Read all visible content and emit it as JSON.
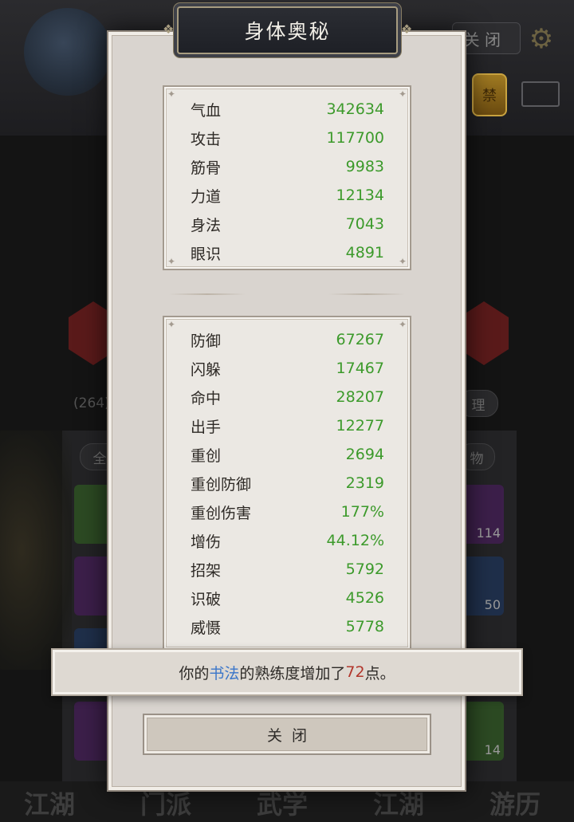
{
  "background": {
    "close_label": "关 闭",
    "badge_char": "禁",
    "count_text": "(264)",
    "manage_label": "理",
    "filter_left_label": "全",
    "filter_right_label": "物",
    "slot_counts": [
      "114",
      "50",
      "14"
    ],
    "nav_labels": [
      "江湖",
      "门派",
      "武学",
      "江湖",
      "游历"
    ]
  },
  "dialog": {
    "title": "身体奥秘",
    "primary_stats": [
      {
        "label": "气血",
        "value": "342634"
      },
      {
        "label": "攻击",
        "value": "117700"
      },
      {
        "label": "筋骨",
        "value": "9983"
      },
      {
        "label": "力道",
        "value": "12134"
      },
      {
        "label": "身法",
        "value": "7043"
      },
      {
        "label": "眼识",
        "value": "4891"
      }
    ],
    "secondary_stats": [
      {
        "label": "防御",
        "value": "67267"
      },
      {
        "label": "闪躲",
        "value": "17467"
      },
      {
        "label": "命中",
        "value": "28207"
      },
      {
        "label": "出手",
        "value": "12277"
      },
      {
        "label": "重创",
        "value": "2694"
      },
      {
        "label": "重创防御",
        "value": "2319"
      },
      {
        "label": "重创伤害",
        "value": "177%"
      },
      {
        "label": "增伤",
        "value": "44.12%"
      },
      {
        "label": "招架",
        "value": "5792"
      },
      {
        "label": "识破",
        "value": "4526"
      },
      {
        "label": "威慑",
        "value": "5778"
      }
    ],
    "close_button": "关闭"
  },
  "toast": {
    "prefix": "你的",
    "skill": "书法",
    "middle": "的熟练度增加了",
    "amount": "72",
    "suffix": "点。"
  },
  "colors": {
    "stat_value": "#3c9a2b",
    "skill_highlight": "#3b76c9",
    "amount_highlight": "#b2372c"
  }
}
